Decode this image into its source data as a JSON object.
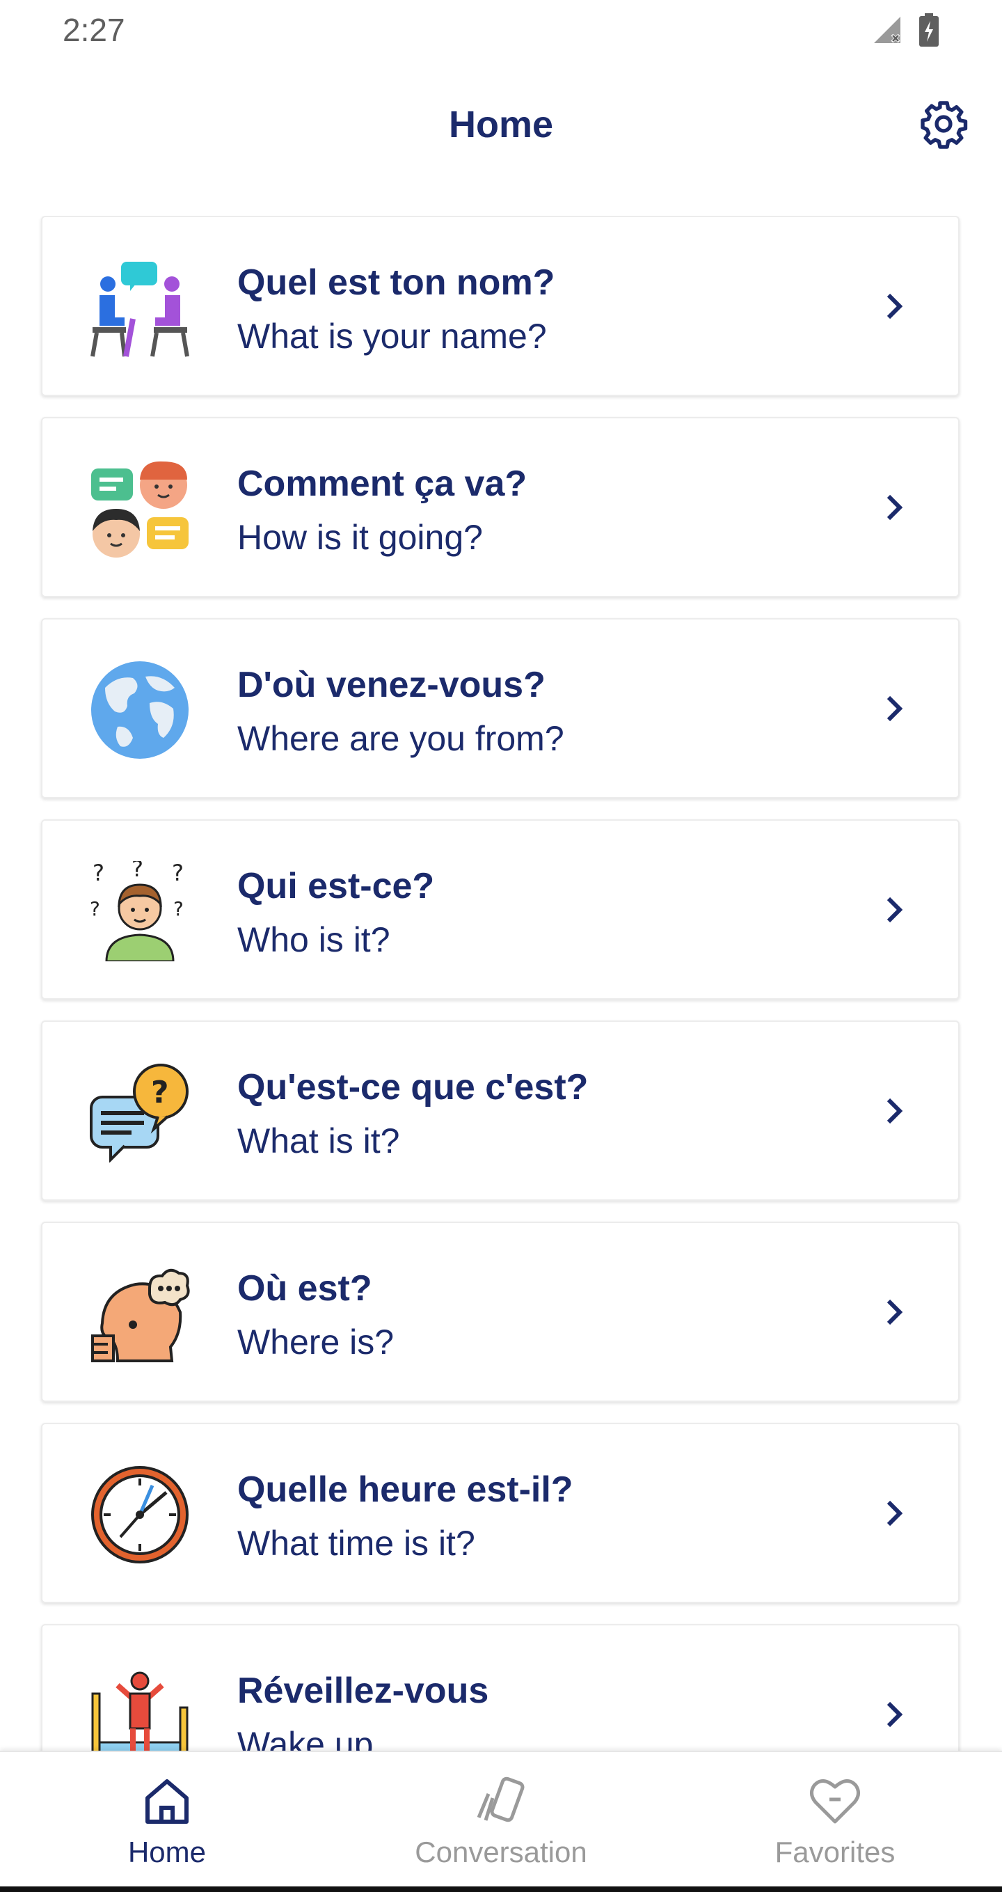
{
  "status_bar": {
    "time": "2:27",
    "icons": [
      "signal-off-icon",
      "battery-charging-icon"
    ]
  },
  "app_bar": {
    "title": "Home",
    "settings_icon": "gear-icon"
  },
  "colors": {
    "primary": "#1b2a6b",
    "inactive": "#9a9a9a",
    "card_border": "#ececec"
  },
  "lessons": [
    {
      "title": "Quel est ton nom?",
      "subtitle": "What is your name?",
      "icon": "conversation-people-icon"
    },
    {
      "title": "Comment ça va?",
      "subtitle": "How is it going?",
      "icon": "chat-faces-icon"
    },
    {
      "title": "D'où venez-vous?",
      "subtitle": "Where are you from?",
      "icon": "globe-icon"
    },
    {
      "title": "Qui est-ce?",
      "subtitle": "Who is it?",
      "icon": "thinking-person-icon"
    },
    {
      "title": "Qu'est-ce que c'est?",
      "subtitle": "What is it?",
      "icon": "question-bubble-icon"
    },
    {
      "title": "Où est?",
      "subtitle": "Where is?",
      "icon": "thinking-head-icon"
    },
    {
      "title": "Quelle heure est-il?",
      "subtitle": "What time is it?",
      "icon": "clock-icon"
    },
    {
      "title": "Réveillez-vous",
      "subtitle": "Wake up",
      "icon": "wake-up-bed-icon"
    }
  ],
  "bottom_nav": [
    {
      "label": "Home",
      "icon": "home-icon",
      "active": true
    },
    {
      "label": "Conversation",
      "icon": "cards-icon",
      "active": false
    },
    {
      "label": "Favorites",
      "icon": "heart-icon",
      "active": false
    }
  ]
}
